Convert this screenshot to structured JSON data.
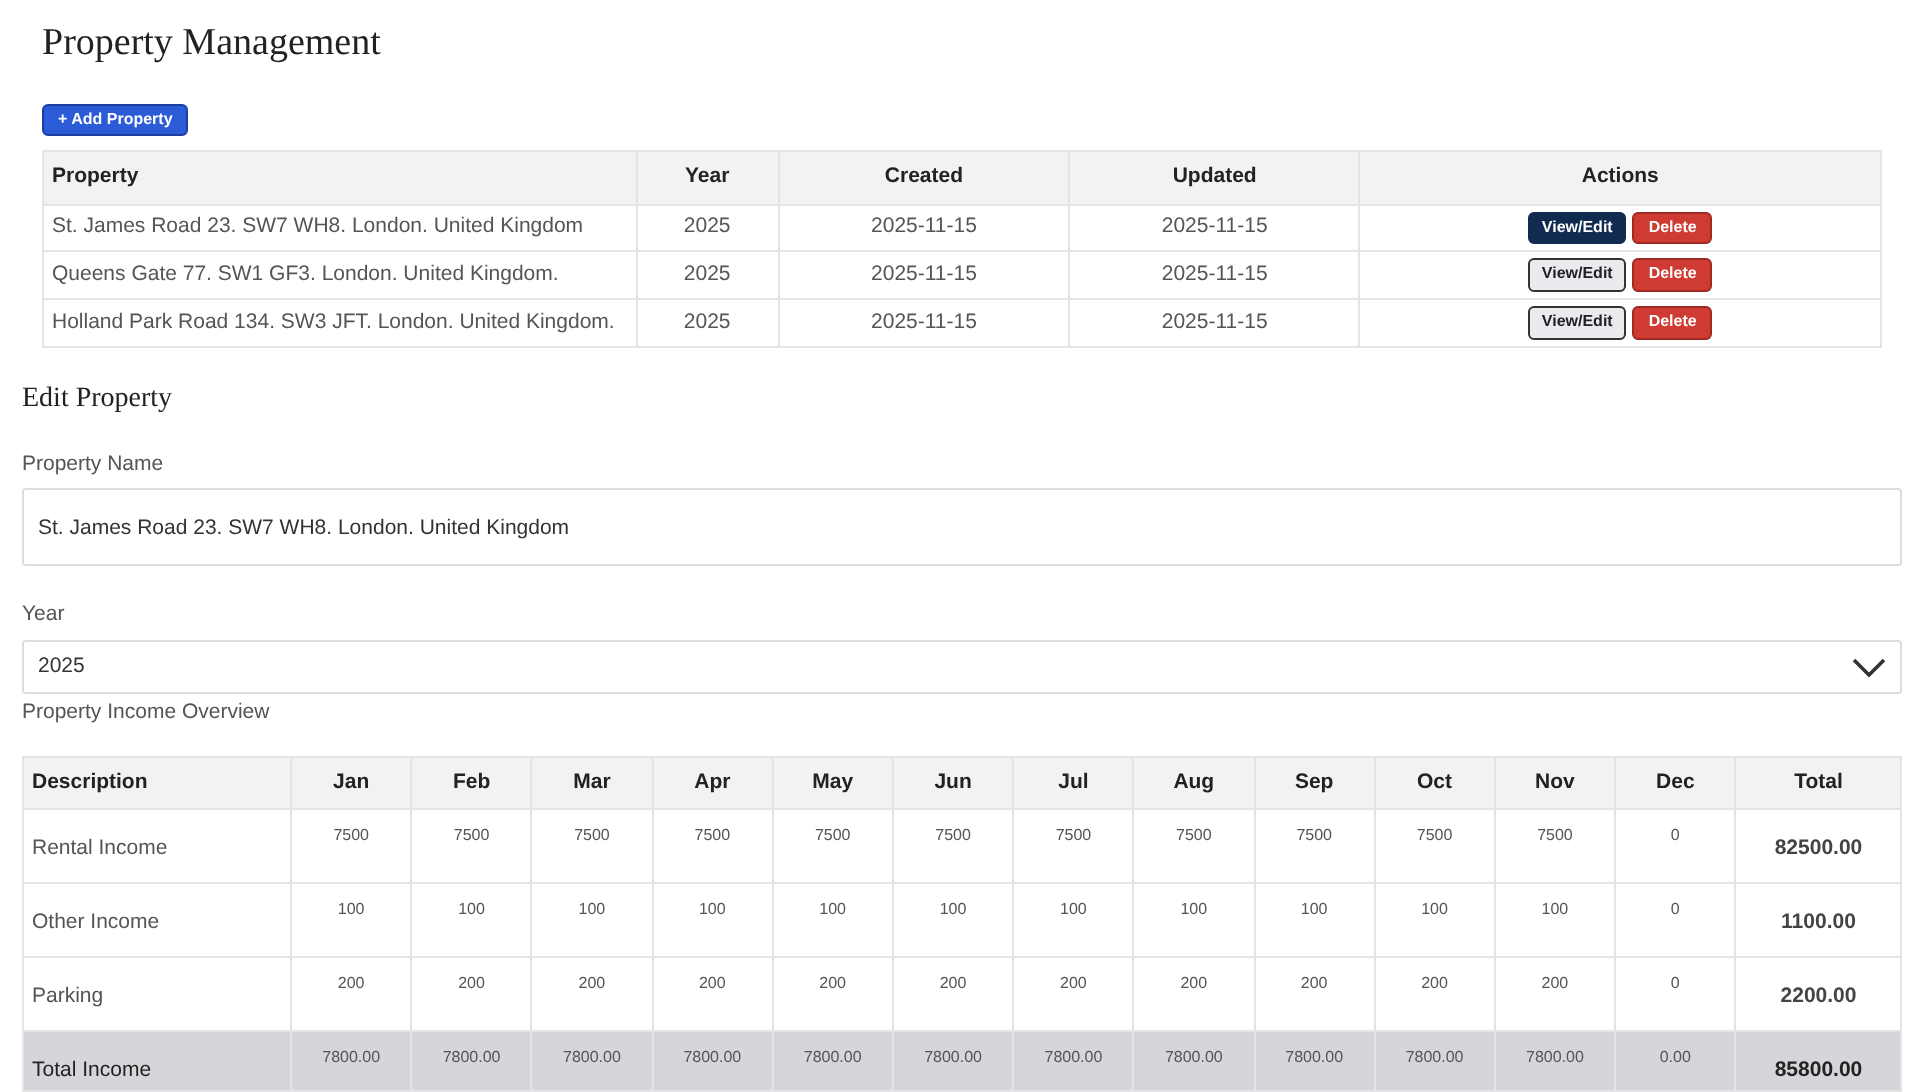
{
  "title": "Property Management",
  "add_button": "+ Add Property",
  "properties_table": {
    "columns": [
      "Property",
      "Year",
      "Created",
      "Updated",
      "Actions"
    ],
    "rows": [
      {
        "property": "St. James Road 23. SW7 WH8. London. United Kingdom",
        "year": "2025",
        "created": "2025-11-15",
        "updated": "2025-11-15",
        "view_button": "View/Edit",
        "delete_button": "Delete",
        "selected": true
      },
      {
        "property": "Queens Gate 77. SW1 GF3. London. United Kingdom.",
        "year": "2025",
        "created": "2025-11-15",
        "updated": "2025-11-15",
        "view_button": "View/Edit",
        "delete_button": "Delete",
        "selected": false
      },
      {
        "property": "Holland Park Road 134. SW3 JFT. London. United Kingdom.",
        "year": "2025",
        "created": "2025-11-15",
        "updated": "2025-11-15",
        "view_button": "View/Edit",
        "delete_button": "Delete",
        "selected": false
      }
    ]
  },
  "edit_section": {
    "heading": "Edit Property",
    "name_field": {
      "label": "Property Name",
      "value": "St. James Road 23. SW7 WH8. London. United Kingdom"
    },
    "year_field": {
      "label": "Year",
      "value": "2025"
    },
    "overview_label": "Property Income Overview"
  },
  "income_table": {
    "columns": [
      "Description",
      "Jan",
      "Feb",
      "Mar",
      "Apr",
      "May",
      "Jun",
      "Jul",
      "Aug",
      "Sep",
      "Oct",
      "Nov",
      "Dec",
      "Total"
    ],
    "rows": [
      {
        "kind": "item",
        "description": "Rental Income",
        "values": [
          "7500",
          "7500",
          "7500",
          "7500",
          "7500",
          "7500",
          "7500",
          "7500",
          "7500",
          "7500",
          "7500",
          "0"
        ],
        "total": "82500.00"
      },
      {
        "kind": "item",
        "description": "Other Income",
        "values": [
          "100",
          "100",
          "100",
          "100",
          "100",
          "100",
          "100",
          "100",
          "100",
          "100",
          "100",
          "0"
        ],
        "total": "1100.00"
      },
      {
        "kind": "item",
        "description": "Parking",
        "values": [
          "200",
          "200",
          "200",
          "200",
          "200",
          "200",
          "200",
          "200",
          "200",
          "200",
          "200",
          "0"
        ],
        "total": "2200.00"
      },
      {
        "kind": "total",
        "description": "Total Income",
        "values": [
          "7800.00",
          "7800.00",
          "7800.00",
          "7800.00",
          "7800.00",
          "7800.00",
          "7800.00",
          "7800.00",
          "7800.00",
          "7800.00",
          "7800.00",
          "0.00"
        ],
        "total": "85800.00"
      }
    ]
  }
}
